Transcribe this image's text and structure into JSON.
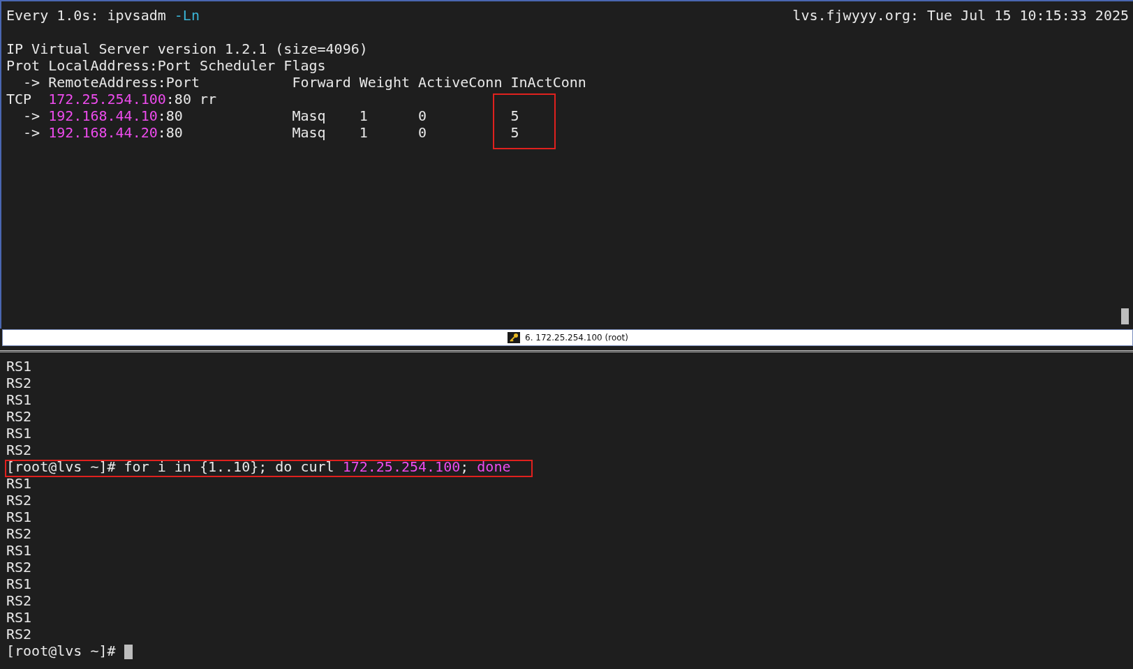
{
  "top_pane": {
    "header_left": [
      {
        "kind": "text",
        "text": "Every 1.0s: ipvsadm "
      },
      {
        "kind": "option",
        "text": "-Ln"
      }
    ],
    "header_right": "lvs.fjwyyy.org: Tue Jul 15 10:15:33 2025",
    "lines": [
      [
        {
          "kind": "text",
          "text": "IP Virtual Server version 1.2.1 (size=4096)"
        }
      ],
      [
        {
          "kind": "text",
          "text": "Prot LocalAddress:Port Scheduler Flags"
        }
      ],
      [
        {
          "kind": "text",
          "text": "  -> RemoteAddress:Port           Forward Weight ActiveConn InActConn"
        }
      ],
      [
        {
          "kind": "text",
          "text": "TCP  "
        },
        {
          "kind": "ip",
          "text": "172.25.254.100"
        },
        {
          "kind": "text",
          "text": ":80 rr"
        }
      ],
      [
        {
          "kind": "text",
          "text": "  -> "
        },
        {
          "kind": "ip",
          "text": "192.168.44.10"
        },
        {
          "kind": "text",
          "text": ":80             Masq    1      0          "
        },
        {
          "kind": "text",
          "text": "5",
          "boxed": true
        }
      ],
      [
        {
          "kind": "text",
          "text": "  -> "
        },
        {
          "kind": "ip",
          "text": "192.168.44.20"
        },
        {
          "kind": "text",
          "text": ":80             Masq    1      0          "
        },
        {
          "kind": "text",
          "text": "5",
          "boxed": true
        }
      ]
    ]
  },
  "tab_bar": {
    "label": "6. 172.25.254.100 (root)"
  },
  "bottom_pane": {
    "lines": [
      [
        {
          "kind": "text",
          "text": "RS1"
        }
      ],
      [
        {
          "kind": "text",
          "text": "RS2"
        }
      ],
      [
        {
          "kind": "text",
          "text": "RS1"
        }
      ],
      [
        {
          "kind": "text",
          "text": "RS2"
        }
      ],
      [
        {
          "kind": "text",
          "text": "RS1"
        }
      ],
      [
        {
          "kind": "text",
          "text": "RS2"
        }
      ],
      [
        {
          "kind": "text",
          "text": "[root@lvs ~]# for i in {1..10}; do curl ",
          "boxed": true
        },
        {
          "kind": "ip",
          "text": "172.25.254.100",
          "boxed": true
        },
        {
          "kind": "text",
          "text": "; ",
          "boxed": true
        },
        {
          "kind": "keyword",
          "text": "done",
          "boxed": true
        }
      ],
      [
        {
          "kind": "text",
          "text": "RS1"
        }
      ],
      [
        {
          "kind": "text",
          "text": "RS2"
        }
      ],
      [
        {
          "kind": "text",
          "text": "RS1"
        }
      ],
      [
        {
          "kind": "text",
          "text": "RS2"
        }
      ],
      [
        {
          "kind": "text",
          "text": "RS1"
        }
      ],
      [
        {
          "kind": "text",
          "text": "RS2"
        }
      ],
      [
        {
          "kind": "text",
          "text": "RS1"
        }
      ],
      [
        {
          "kind": "text",
          "text": "RS2"
        }
      ],
      [
        {
          "kind": "text",
          "text": "RS1"
        }
      ],
      [
        {
          "kind": "text",
          "text": "RS2"
        }
      ],
      [
        {
          "kind": "text",
          "text": "[root@lvs ~]# "
        }
      ]
    ],
    "cursor": true
  }
}
